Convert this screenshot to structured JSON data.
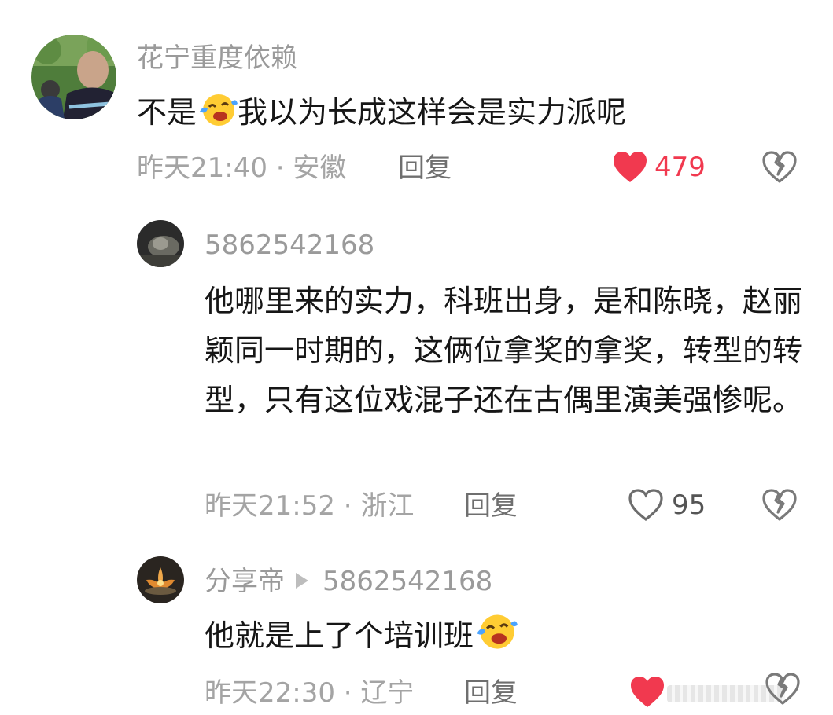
{
  "comments": [
    {
      "username": "花宁重度依赖",
      "text_before": "不是",
      "text_after": "我以为长成这样会是实力派呢",
      "time_location": "昨天21:40 · 安徽",
      "reply_label": "回复",
      "likes": "479",
      "liked": true,
      "emoji": "laughing-crying-emoji"
    },
    {
      "username": "5862542168",
      "text": "他哪里来的实力，科班出身，是和陈晓，赵丽颖同一时期的，这俩位拿奖的拿奖，转型的转型，只有这位戏混子还在古偶里演美强惨呢。",
      "time_location": "昨天21:52 · 浙江",
      "reply_label": "回复",
      "likes": "95",
      "liked": false
    },
    {
      "username": "分享帝",
      "reply_to": "5862542168",
      "text_before": "他就是上了个培训班",
      "time_location": "昨天22:30 · 辽宁",
      "reply_label": "回复",
      "liked": true,
      "emoji": "laughing-crying-emoji"
    }
  ],
  "colors": {
    "like_red": "#f1394f",
    "meta_gray": "#a4a4a4",
    "name_gray": "#9a9a9a"
  },
  "icons": [
    "heart-icon",
    "broken-heart-icon",
    "reply-arrow-icon"
  ]
}
